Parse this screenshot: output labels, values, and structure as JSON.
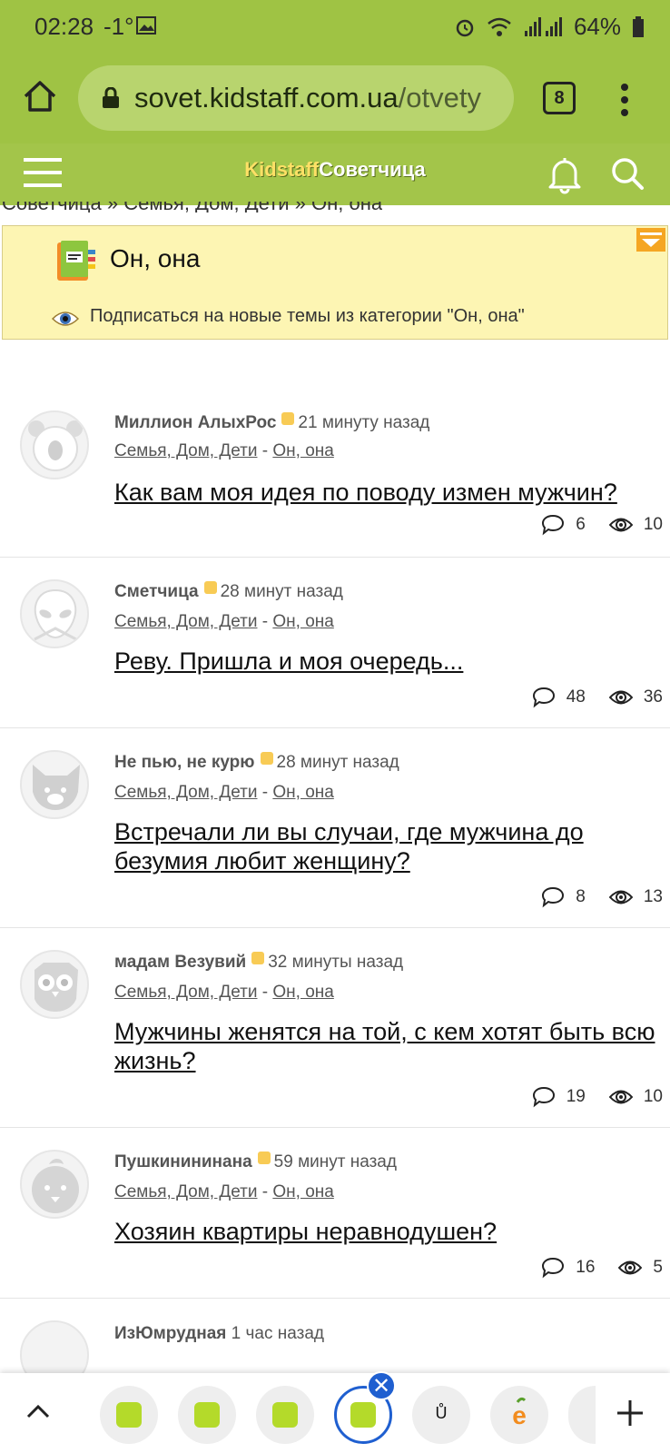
{
  "status": {
    "time": "02:28",
    "temp": "-1°",
    "battery": "64%"
  },
  "browser": {
    "url_host": "sovet.kidstaff.com.ua",
    "url_path": "/otvety",
    "tab_count": "8"
  },
  "site": {
    "brand": "Kidstaff",
    "name": "Советчица"
  },
  "breadcrumb": "Советчица » Семья, Дом, Дети » Он, она",
  "category": {
    "title": "Он, она",
    "subscribe": "Подписаться на новые темы из категории \"Он, она\""
  },
  "topics": [
    {
      "author": "Миллион АлыхРос",
      "time": "21 минуту назад",
      "cat1": "Семья, Дом, Дети",
      "sep": "-",
      "cat2": "Он, она",
      "title": "Как вам моя идея по поводу измен мужчин?",
      "comments": "6",
      "views": "10"
    },
    {
      "author": "Сметчица",
      "time": "28 минут назад",
      "cat1": "Семья, Дом, Дети",
      "sep": "-",
      "cat2": "Он, она",
      "title": "Реву. Пришла и моя очередь...",
      "comments": "48",
      "views": "36"
    },
    {
      "author": "Не пью, не курю",
      "time": "28 минут назад",
      "cat1": "Семья, Дом, Дети",
      "sep": "-",
      "cat2": "Он, она",
      "title": "Встречали ли вы случаи, где мужчина до безумия любит женщину?",
      "comments": "8",
      "views": "13"
    },
    {
      "author": "мадам Везувий",
      "time": "32 минуты назад",
      "cat1": "Семья, Дом, Дети",
      "sep": "-",
      "cat2": "Он, она",
      "title": "Мужчины женятся на той, с кем хотят быть всю жизнь?",
      "comments": "19",
      "views": "10"
    },
    {
      "author": "Пушкинининана",
      "time": "59 минут назад",
      "cat1": "Семья, Дом, Дети",
      "sep": "-",
      "cat2": "Он, она",
      "title": "Хозяин квартиры неравнодушен?",
      "comments": "16",
      "views": "5"
    },
    {
      "author": "ИзЮмрудная",
      "time": "1 час назад"
    }
  ],
  "bottom_tabs": {
    "letter_tab": "Ů"
  },
  "colors": {
    "header_green": "#9fc344",
    "category_bg": "#fdf5b3",
    "active_tab_blue": "#1f5fd0"
  }
}
